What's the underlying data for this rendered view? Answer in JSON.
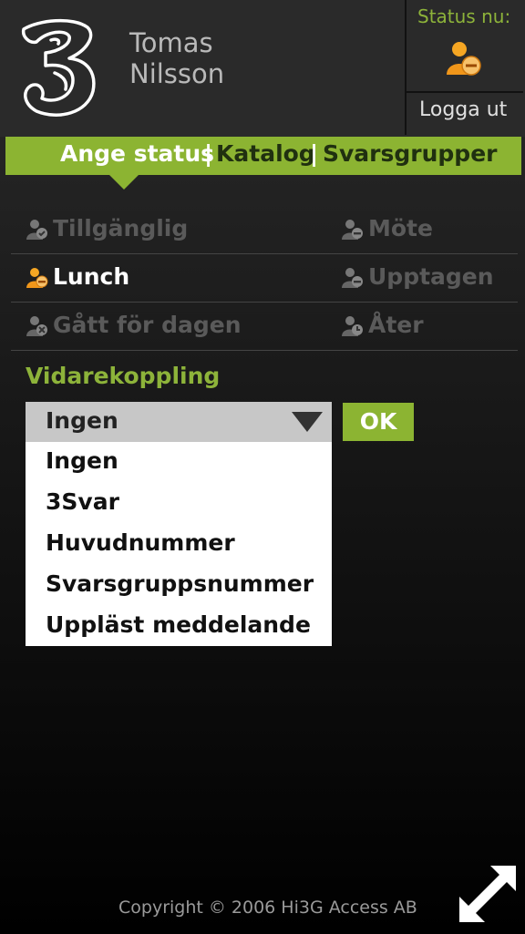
{
  "header": {
    "user_first": "Tomas",
    "user_last": "Nilsson",
    "status_label": "Status nu:",
    "logout_label": "Logga ut"
  },
  "tabs": [
    {
      "label": "Ange status"
    },
    {
      "label": "Katalog"
    },
    {
      "label": "Svarsgrupper"
    }
  ],
  "tab_separator": "|",
  "status_options": [
    {
      "label": "Tillgänglig",
      "state": "dim",
      "icon": "person-available-icon"
    },
    {
      "label": "Möte",
      "state": "dim",
      "icon": "person-meeting-icon"
    },
    {
      "label": "Lunch",
      "state": "active",
      "icon": "person-lunch-icon"
    },
    {
      "label": "Upptagen",
      "state": "dim",
      "icon": "person-busy-icon"
    },
    {
      "label": "Gått för dagen",
      "state": "dim",
      "icon": "person-gone-icon"
    },
    {
      "label": "Åter",
      "state": "dim",
      "icon": "person-back-icon"
    }
  ],
  "forwarding": {
    "title": "Vidarekoppling",
    "selected": "Ingen",
    "ok_label": "OK",
    "options": [
      "Ingen",
      "3Svar",
      "Huvudnummer",
      "Svarsgruppsnummer",
      "Uppläst meddelande"
    ]
  },
  "footer": {
    "copyright": "Copyright © 2006 Hi3G Access AB"
  },
  "colors": {
    "accent": "#8cb432",
    "status_orange": "#f0a020"
  }
}
